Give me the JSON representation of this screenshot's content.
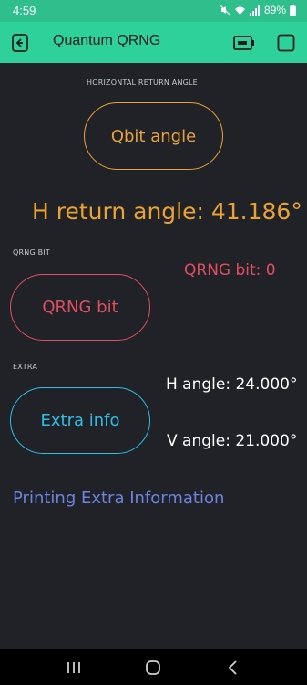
{
  "status_bar": {
    "time": "4:59",
    "battery": "89%"
  },
  "app_bar": {
    "title": "Quantum QRNG"
  },
  "sections": {
    "horizontal_label": "HORIZONTAL RETURN ANGLE",
    "qrng_label": "QRNG BIT",
    "extra_label": "EXTRA"
  },
  "buttons": {
    "qbit_angle": "Qbit angle",
    "qrng_bit": "QRNG bit",
    "extra_info": "Extra info"
  },
  "values": {
    "h_return_angle": "H return angle: 41.186°",
    "qrng_bit": "QRNG bit: 0",
    "h_angle": "H angle: 24.000°",
    "v_angle": "V angle: 21.000°",
    "printing_extra": "Printing Extra Information"
  },
  "colors": {
    "app_bar": "#2dd199",
    "background": "#212227",
    "orange": "#e8a334",
    "red": "#e14e61",
    "cyan": "#2cbfe6",
    "blue": "#6b84e0"
  },
  "icons": {
    "back": "back-icon",
    "device": "device-icon",
    "square": "square-icon"
  }
}
